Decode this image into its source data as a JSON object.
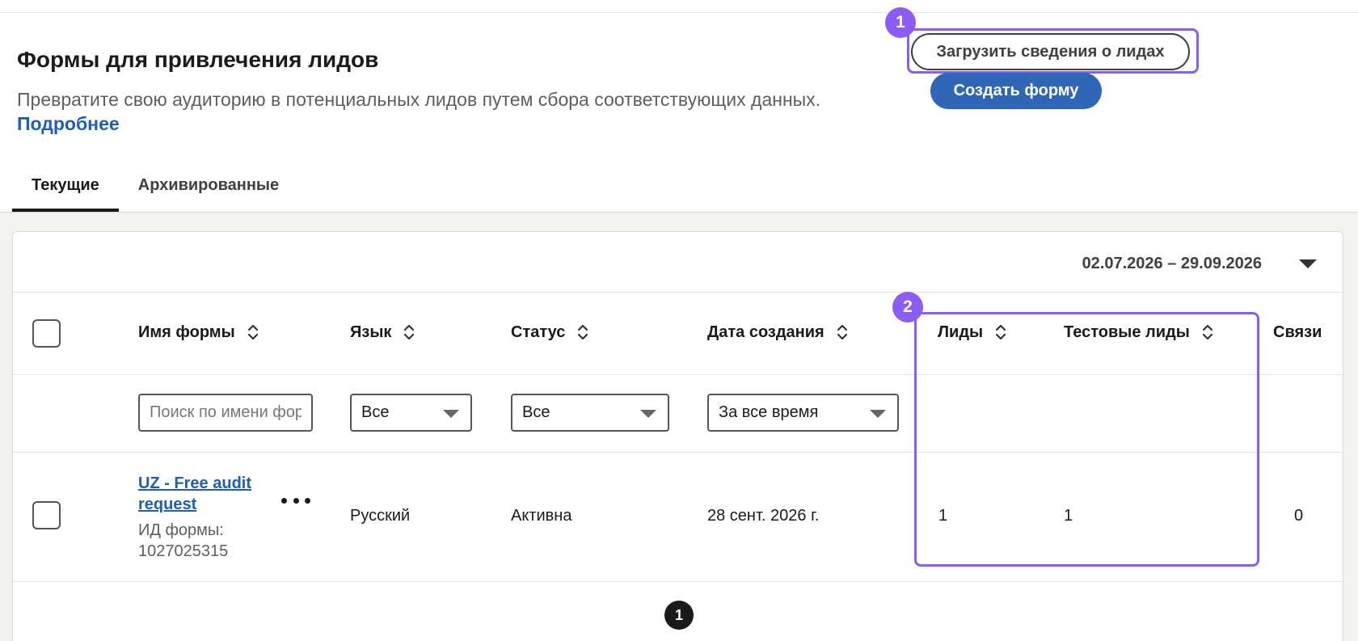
{
  "header": {
    "title": "Формы для привлечения лидов",
    "description": "Превратите свою аудиторию в потенциальных лидов путем сбора соответствующих данных.",
    "learn_more": "Подробнее",
    "upload_button": "Загрузить сведения о лидах",
    "create_button": "Создать форму"
  },
  "annotations": {
    "badge1": "1",
    "badge2": "2",
    "color": "#8b5cf6"
  },
  "tabs": [
    {
      "label": "Текущие",
      "active": true
    },
    {
      "label": "Архивированные",
      "active": false
    }
  ],
  "table": {
    "date_range": "02.07.2026 – 29.09.2026",
    "columns": {
      "form_name": "Имя формы",
      "language": "Язык",
      "status": "Статус",
      "created": "Дата создания",
      "leads": "Лиды",
      "test_leads": "Тестовые лиды",
      "connections": "Связи"
    },
    "filters": {
      "search_placeholder": "Поиск по имени формы",
      "language": "Все",
      "status": "Все",
      "created": "За все время"
    },
    "rows": [
      {
        "name": "UZ - Free audit request",
        "form_id": "ИД формы: 1027025315",
        "language": "Русский",
        "status": "Активна",
        "created": "28 сент. 2026 г.",
        "leads": "1",
        "test_leads": "1",
        "connections": "0"
      }
    ],
    "pagination": {
      "current_page": "1"
    }
  },
  "colors": {
    "primary": "#2f66b8",
    "link": "#1f5fae",
    "highlight": "#8b5cf6"
  }
}
